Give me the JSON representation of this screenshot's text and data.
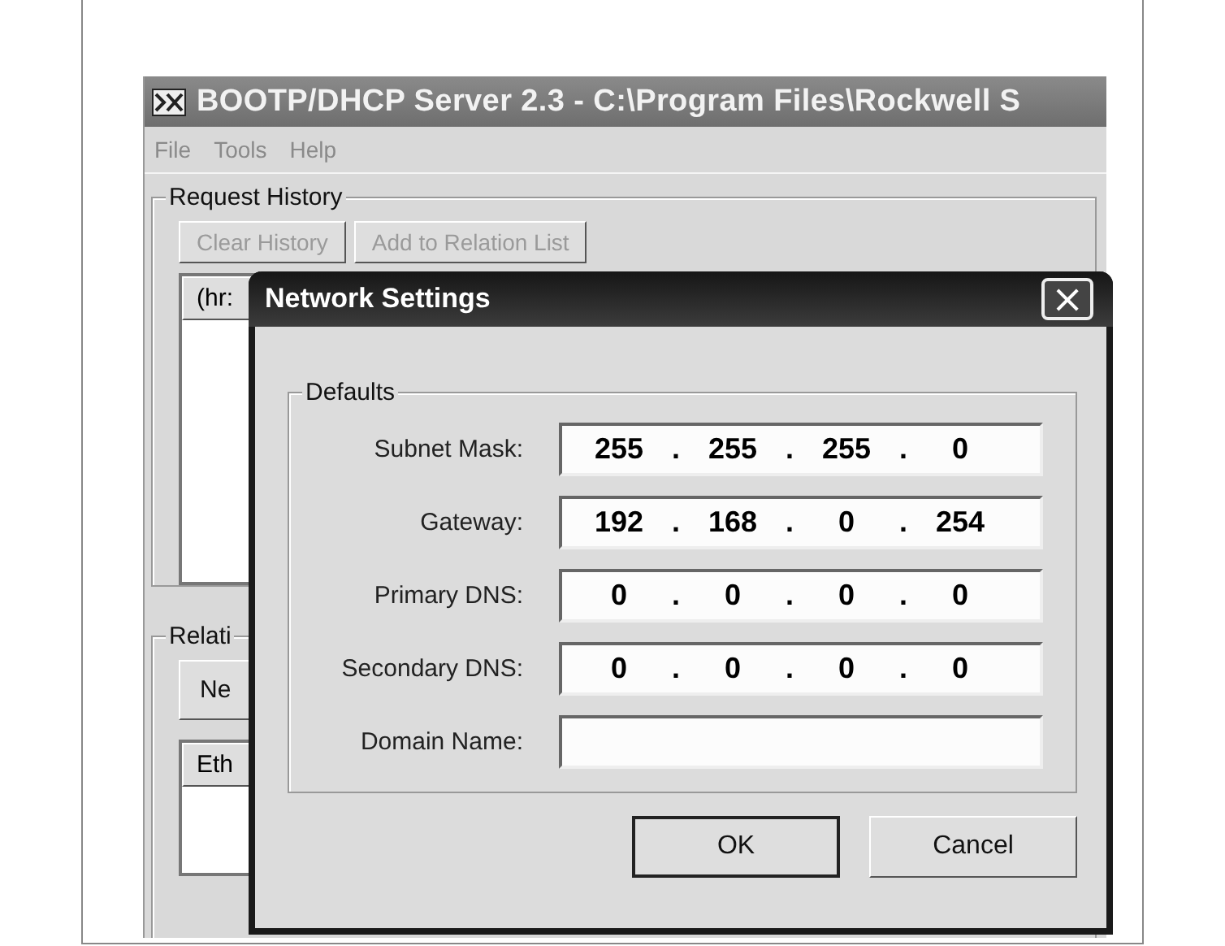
{
  "window": {
    "title": "BOOTP/DHCP Server 2.3 - C:\\Program Files\\Rockwell S"
  },
  "menu": [
    "File",
    "Tools",
    "Help"
  ],
  "request_history": {
    "title": "Request History",
    "buttons": [
      {
        "label": "Clear History",
        "disabled": true
      },
      {
        "label": "Add to Relation List",
        "disabled": true
      }
    ],
    "list_header": "(hr:"
  },
  "relation_list": {
    "title": "Relati",
    "buttons": [
      {
        "label": "Ne",
        "disabled": false
      }
    ],
    "list_header": "Eth"
  },
  "dialog": {
    "title": "Network Settings",
    "close": "×",
    "group": "Defaults",
    "fields": [
      {
        "label": "Subnet Mask:",
        "kind": "ip",
        "separator": ".",
        "octets": [
          "255",
          "255",
          "255",
          "0"
        ]
      },
      {
        "label": "Gateway:",
        "kind": "ip",
        "separator": ".",
        "octets": [
          "192",
          "168",
          "0",
          "254"
        ]
      },
      {
        "label": "Primary DNS:",
        "kind": "ip",
        "separator": ".",
        "octets": [
          "0",
          "0",
          "0",
          "0"
        ]
      },
      {
        "label": "Secondary DNS:",
        "kind": "ip",
        "separator": ".",
        "octets": [
          "0",
          "0",
          "0",
          "0"
        ]
      },
      {
        "label": "Domain Name:",
        "kind": "text"
      }
    ],
    "buttons": [
      {
        "label": "OK",
        "default": true
      },
      {
        "label": "Cancel",
        "default": false
      }
    ]
  }
}
